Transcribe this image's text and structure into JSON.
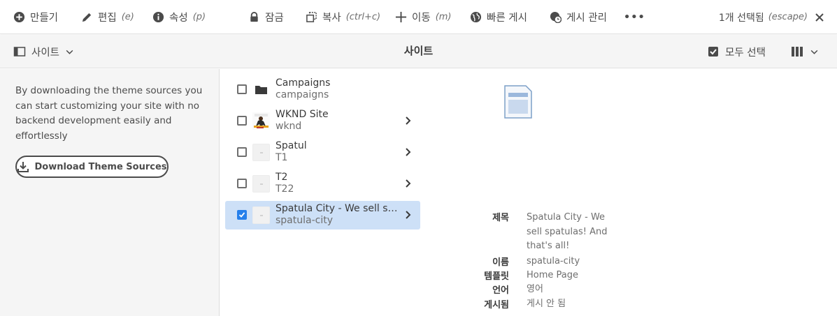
{
  "actionbar": {
    "create": {
      "label": "만들기"
    },
    "edit": {
      "label": "편집",
      "shortcut": "(e)"
    },
    "properties": {
      "label": "속성",
      "shortcut": "(p)"
    },
    "lock": {
      "label": "잠금"
    },
    "copy": {
      "label": "복사",
      "shortcut": "(ctrl+c)"
    },
    "move": {
      "label": "이동",
      "shortcut": "(m)"
    },
    "quick_publish": {
      "label": "빠른 게시"
    },
    "manage_publication": {
      "label": "게시 관리"
    },
    "more": {
      "label": "•••"
    },
    "selection": {
      "label": "1개 선택됨",
      "shortcut": "(escape)"
    }
  },
  "subbar": {
    "rail_toggle_label": "사이트",
    "title": "사이트",
    "select_all_label": "모두 선택"
  },
  "rail": {
    "description": "By downloading the theme sources you can start customizing your site with no backend development easily and effortlessly",
    "download_button": "Download Theme Sources"
  },
  "column": {
    "items": [
      {
        "title": "Campaigns",
        "name": "campaigns",
        "thumb": "folder-icon",
        "checked": false,
        "has_children": false
      },
      {
        "title": "WKND Site",
        "name": "wknd",
        "thumb": "site-thumbnail",
        "checked": false,
        "has_children": true
      },
      {
        "title": "Spatul",
        "name": "T1",
        "thumb": "blank",
        "checked": false,
        "has_children": true
      },
      {
        "title": "T2",
        "name": "T22",
        "thumb": "blank",
        "checked": false,
        "has_children": true
      },
      {
        "title": "Spatula City - We sell spatulas! And that's all!",
        "name": "spatula-city",
        "thumb": "blank",
        "checked": true,
        "has_children": true
      }
    ]
  },
  "preview": {
    "page_icon": "page-icon",
    "fields": [
      {
        "label": "제목",
        "value_lines": [
          "Spatula City - We",
          "sell spatulas! And",
          "that's all!"
        ]
      },
      {
        "label": "이름",
        "value_lines": [
          "spatula-city"
        ]
      },
      {
        "label": "템플릿",
        "value_lines": [
          "Home Page"
        ]
      },
      {
        "label": "언어",
        "value_lines": [
          "영어"
        ]
      },
      {
        "label": "게시됨",
        "value_lines": [
          "게시 안 됨"
        ]
      }
    ]
  },
  "colors": {
    "accent": "#2680eb",
    "selected_row": "#cde0f7",
    "text": "#4b4b4b"
  }
}
